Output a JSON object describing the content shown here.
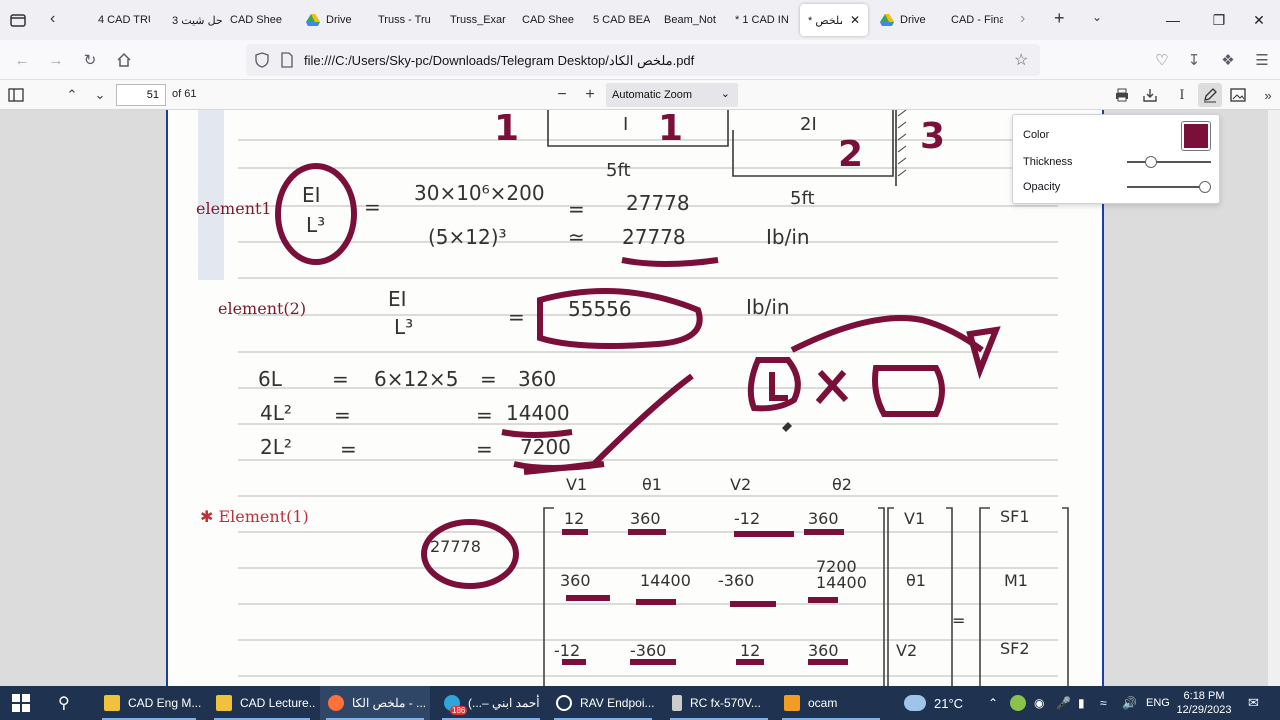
{
  "browser": {
    "tabs": [
      {
        "label": "4 CAD TRU",
        "icon": "pdf-icon"
      },
      {
        "label": "3 حل شيت",
        "icon": "pdf-icon"
      },
      {
        "label": "CAD Shee",
        "icon": "pdf-icon"
      },
      {
        "label": "Drive",
        "icon": "google-drive-icon"
      },
      {
        "label": "Truss - Tru",
        "icon": "pdf-icon"
      },
      {
        "label": "Truss_Exar",
        "icon": "pdf-icon"
      },
      {
        "label": "CAD Shee",
        "icon": "pdf-icon"
      },
      {
        "label": "5 CAD BEA",
        "icon": "pdf-icon"
      },
      {
        "label": "Beam_Not",
        "icon": "pdf-icon"
      },
      {
        "label": "* 1 CAD IN",
        "icon": "pdf-icon"
      },
      {
        "label": "* ملخص",
        "icon": "pdf-icon",
        "active": true
      },
      {
        "label": "Drive",
        "icon": "google-drive-icon"
      },
      {
        "label": "CAD - Fina",
        "icon": "pdf-icon"
      }
    ],
    "url": "file:///C:/Users/Sky-pc/Downloads/Telegram Desktop/ملخص الكاد.pdf"
  },
  "pdf_toolbar": {
    "page_number": "51",
    "page_count_label": "of 61",
    "zoom_label": "Automatic Zoom"
  },
  "draw_popup": {
    "color_label": "Color",
    "thickness_label": "Thickness",
    "opacity_label": "Opacity",
    "color_value": "#7a0f3a",
    "thickness_fraction": 0.25,
    "opacity_fraction": 1.0
  },
  "taskbar": {
    "items": [
      {
        "label": "CAD Eng M...",
        "icon": "file-icon"
      },
      {
        "label": "CAD Lecture...",
        "icon": "file-icon"
      },
      {
        "label": "ملخص الكا - ...",
        "icon": "firefox-icon"
      },
      {
        "label": "(...– أحمد ابني",
        "icon": "telegram-icon",
        "badge": "186"
      },
      {
        "label": "RAV Endpoi...",
        "icon": "rav-icon"
      },
      {
        "label": "RC fx-570V...",
        "icon": "calculator-icon"
      },
      {
        "label": "ocam",
        "icon": "ocam-icon"
      }
    ],
    "weather": "21°C",
    "language": "ENG",
    "time": "6:18 PM",
    "date": "12/29/2023"
  },
  "colors": {
    "ink": "#7a0f3a",
    "pen_red": "#c0303a",
    "taskbar": "#1f3350",
    "accent": "#1b3fa0"
  }
}
